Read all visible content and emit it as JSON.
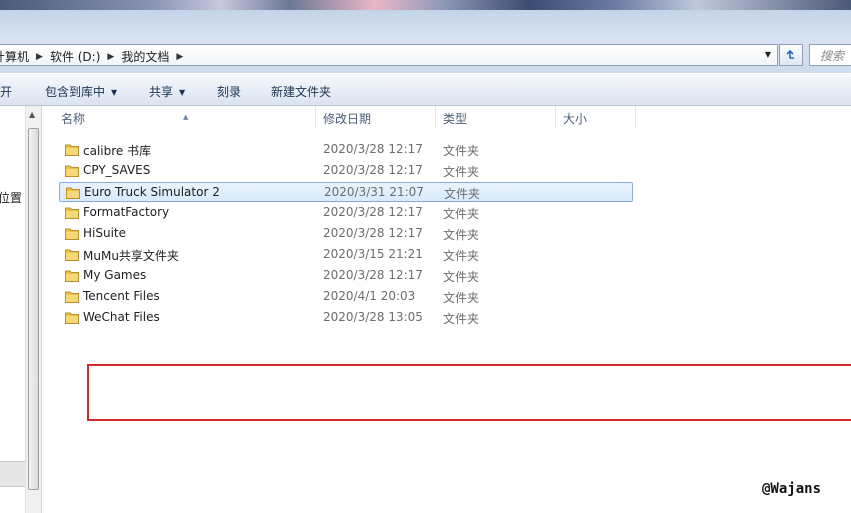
{
  "address": {
    "crumbs": [
      "计算机",
      "软件 (D:)",
      "我的文档"
    ],
    "search_placeholder": "搜索"
  },
  "toolbar": {
    "open_label": "打开",
    "include_library_label": "包含到库中",
    "share_label": "共享",
    "burn_label": "刻录",
    "new_folder_label": "新建文件夹"
  },
  "navpane": {
    "partial_label": "位置"
  },
  "columns": {
    "name": "名称",
    "date": "修改日期",
    "type": "类型",
    "size": "大小"
  },
  "files": [
    {
      "name": "calibre 书库",
      "date": "2020/3/28 12:17",
      "type": "文件夹",
      "selected": false
    },
    {
      "name": "CPY_SAVES",
      "date": "2020/3/28 12:17",
      "type": "文件夹",
      "selected": false
    },
    {
      "name": "Euro Truck Simulator 2",
      "date": "2020/3/31 21:07",
      "type": "文件夹",
      "selected": true
    },
    {
      "name": "FormatFactory",
      "date": "2020/3/28 12:17",
      "type": "文件夹",
      "selected": false
    },
    {
      "name": "HiSuite",
      "date": "2020/3/28 12:17",
      "type": "文件夹",
      "selected": false
    },
    {
      "name": "MuMu共享文件夹",
      "date": "2020/3/15 21:21",
      "type": "文件夹",
      "selected": false
    },
    {
      "name": "My Games",
      "date": "2020/3/28 12:17",
      "type": "文件夹",
      "selected": false
    },
    {
      "name": "Tencent Files",
      "date": "2020/4/1 20:03",
      "type": "文件夹",
      "selected": false
    },
    {
      "name": "WeChat Files",
      "date": "2020/3/28 13:05",
      "type": "文件夹",
      "selected": false
    }
  ],
  "watermark": "@Wajans",
  "colors": {
    "selection_border": "#84acdd",
    "highlight_box": "#d22a2a",
    "folder": "#e8c04a"
  }
}
